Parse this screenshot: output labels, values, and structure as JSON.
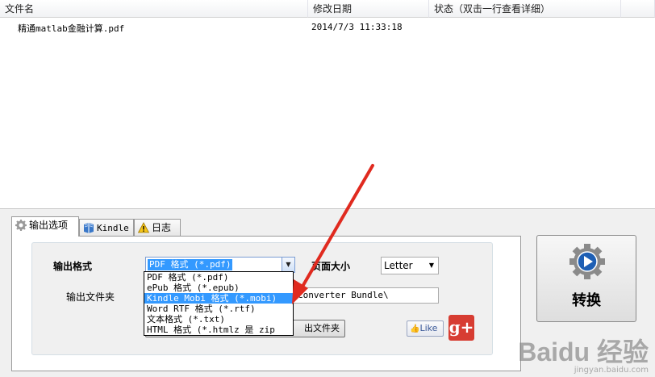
{
  "file_list": {
    "columns": [
      "文件名",
      "修改日期",
      "状态（双击一行查看详细）"
    ],
    "rows": [
      {
        "name": "精通matlab金融计算.pdf",
        "modified": "2014/7/3 11:33:18",
        "status": ""
      }
    ]
  },
  "tabs": [
    {
      "label": "输出选项",
      "icon": "gear-icon",
      "active": true
    },
    {
      "label": "Kindle",
      "icon": "kindle-book-icon",
      "active": false
    },
    {
      "label": "日志",
      "icon": "warning-icon",
      "active": false
    }
  ],
  "options": {
    "format_label": "输出格式",
    "format_selected": "PDF 格式 (*.pdf)",
    "format_options": [
      "PDF 格式 (*.pdf)",
      "ePub 格式 (*.epub)",
      "Kindle Mobi 格式 (*.mobi)",
      "Word RTF 格式 (*.rtf)",
      "文本格式 (*.txt)",
      "HTML 格式 (*.htmlz 是 zip"
    ],
    "format_highlighted_index": 2,
    "page_size_label": "页面大小",
    "page_size_value": "Letter",
    "folder_label": "输出文件夹",
    "folder_value": "Converter Bundle\\",
    "open_folder_label": "出文件夹",
    "like_label": "Like",
    "gplus_label": "g+"
  },
  "convert_label": "转换",
  "watermark": {
    "main": "Baidu 经验",
    "sub": "jingyan.baidu.com"
  },
  "colors": {
    "selection": "#3399ff",
    "arrow": "#e02a1f",
    "gplus": "#d73d32"
  }
}
